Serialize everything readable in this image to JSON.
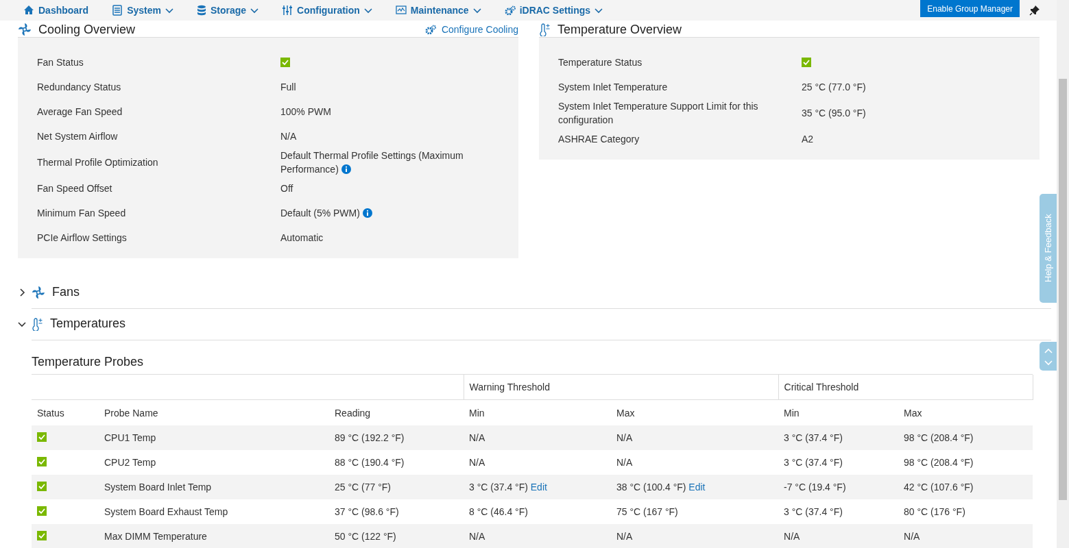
{
  "nav": {
    "items": [
      {
        "label": "Dashboard",
        "dropdown": false
      },
      {
        "label": "System",
        "dropdown": true
      },
      {
        "label": "Storage",
        "dropdown": true
      },
      {
        "label": "Configuration",
        "dropdown": true
      },
      {
        "label": "Maintenance",
        "dropdown": true
      },
      {
        "label": "iDRAC Settings",
        "dropdown": true
      }
    ],
    "button": "Enable Group Manager"
  },
  "cooling_overview": {
    "title": "Cooling Overview",
    "action": "Configure Cooling",
    "rows": [
      {
        "label": "Fan Status",
        "kind": "status",
        "ok": true
      },
      {
        "label": "Redundancy Status",
        "kind": "text",
        "value": "Full"
      },
      {
        "label": "Average Fan Speed",
        "kind": "text",
        "value": "100% PWM"
      },
      {
        "label": "Net System Airflow",
        "kind": "text",
        "value": "N/A"
      },
      {
        "label": "Thermal Profile Optimization",
        "kind": "text",
        "value": "Default Thermal Profile Settings (Maximum Performance)",
        "info": true
      },
      {
        "label": "Fan Speed Offset",
        "kind": "text",
        "value": "Off"
      },
      {
        "label": "Minimum Fan Speed",
        "kind": "text",
        "value": "Default (5% PWM)",
        "info": true
      },
      {
        "label": "PCIe Airflow Settings",
        "kind": "text",
        "value": "Automatic"
      }
    ]
  },
  "temperature_overview": {
    "title": "Temperature Overview",
    "rows": [
      {
        "label": "Temperature Status",
        "kind": "status",
        "ok": true
      },
      {
        "label": "System Inlet Temperature",
        "kind": "text",
        "value": "25 °C (77.0 °F)"
      },
      {
        "label": "System Inlet Temperature Support Limit for this configuration",
        "kind": "text",
        "value": "35 °C (95.0 °F)"
      },
      {
        "label": "ASHRAE Category",
        "kind": "text",
        "value": "A2"
      }
    ]
  },
  "sections": [
    {
      "title": "Fans",
      "expanded": false
    },
    {
      "title": "Temperatures",
      "expanded": true
    }
  ],
  "probes": {
    "title": "Temperature Probes",
    "groups": [
      "Warning Threshold",
      "Critical Threshold"
    ],
    "columns": [
      "Status",
      "Probe Name",
      "Reading",
      "Min",
      "Max",
      "Min",
      "Max"
    ],
    "rows": [
      {
        "cells": [
          {
            "kind": "status",
            "ok": true
          },
          {
            "text": "CPU1 Temp"
          },
          {
            "text": "89 °C (192.2 °F)"
          },
          {
            "text": "N/A"
          },
          {
            "text": "N/A"
          },
          {
            "text": "3 °C (37.4 °F)"
          },
          {
            "text": "98 °C (208.4 °F)"
          }
        ]
      },
      {
        "cells": [
          {
            "kind": "status",
            "ok": true
          },
          {
            "text": "CPU2 Temp"
          },
          {
            "text": "88 °C (190.4 °F)"
          },
          {
            "text": "N/A"
          },
          {
            "text": "N/A"
          },
          {
            "text": "3 °C (37.4 °F)"
          },
          {
            "text": "98 °C (208.4 °F)"
          }
        ]
      },
      {
        "cells": [
          {
            "kind": "status",
            "ok": true
          },
          {
            "text": "System Board Inlet Temp"
          },
          {
            "text": "25 °C (77 °F)"
          },
          {
            "text": "3 °C (37.4 °F)",
            "link": "Edit"
          },
          {
            "text": "38 °C (100.4 °F)",
            "link": "Edit"
          },
          {
            "text": "-7 °C (19.4 °F)"
          },
          {
            "text": "42 °C (107.6 °F)"
          }
        ]
      },
      {
        "cells": [
          {
            "kind": "status",
            "ok": true
          },
          {
            "text": "System Board Exhaust Temp"
          },
          {
            "text": "37 °C (98.6 °F)"
          },
          {
            "text": "8 °C (46.4 °F)"
          },
          {
            "text": "75 °C (167 °F)"
          },
          {
            "text": "3 °C (37.4 °F)"
          },
          {
            "text": "80 °C (176 °F)"
          }
        ]
      },
      {
        "cells": [
          {
            "kind": "status",
            "ok": true
          },
          {
            "text": "Max DIMM Temperature"
          },
          {
            "text": "50 °C (122 °F)"
          },
          {
            "text": "N/A"
          },
          {
            "text": "N/A"
          },
          {
            "text": "N/A"
          },
          {
            "text": "N/A"
          }
        ]
      }
    ]
  },
  "help_tab": "Help & Feedback"
}
